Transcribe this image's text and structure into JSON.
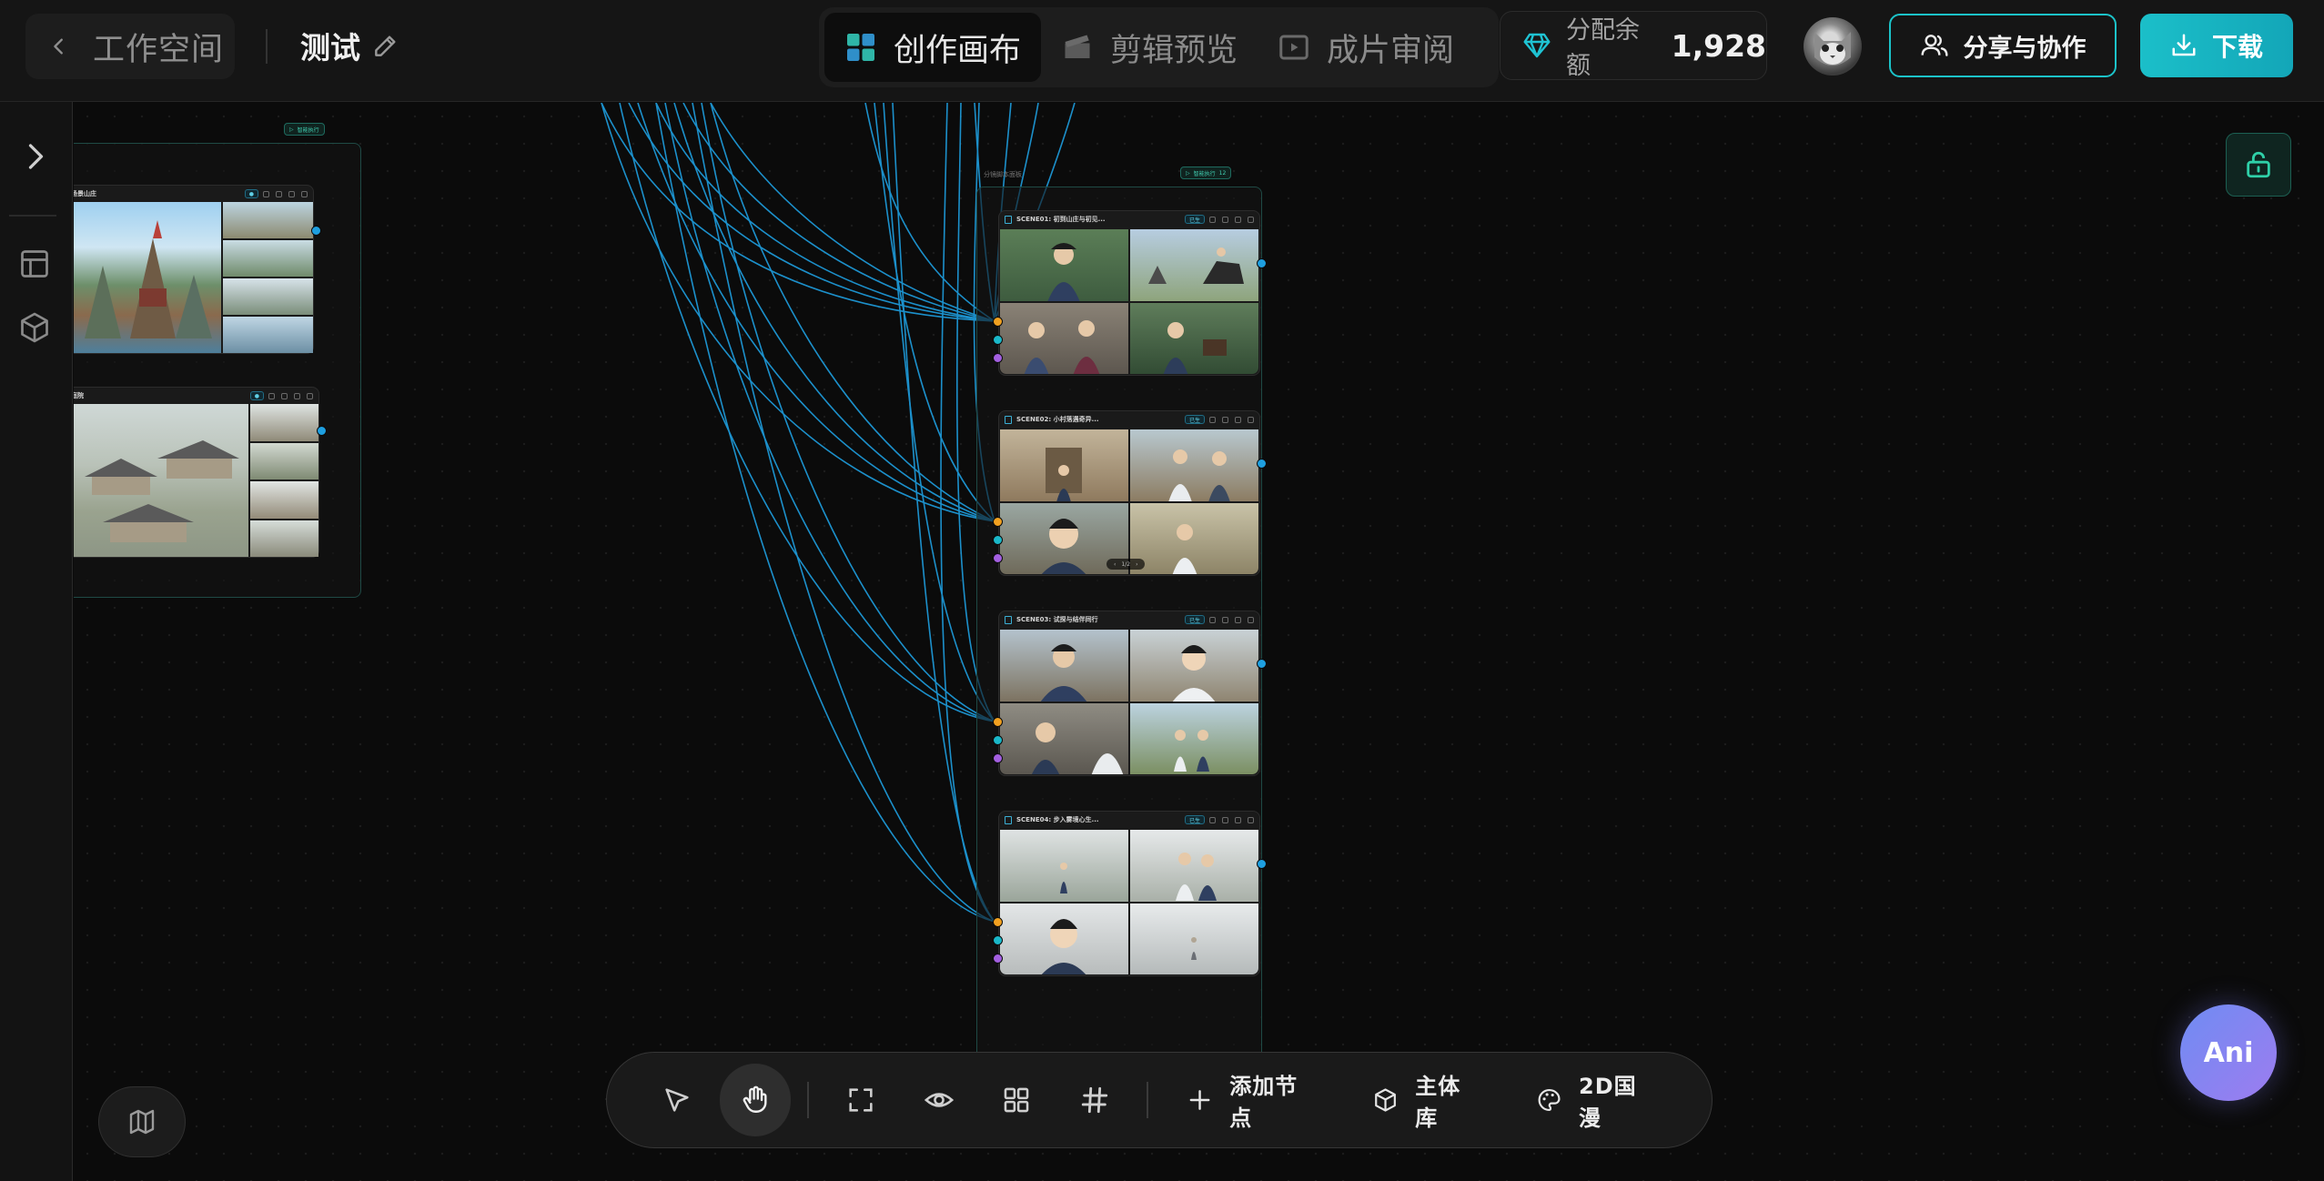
{
  "header": {
    "back_label": "工作空间",
    "project_title": "测试",
    "modes": [
      {
        "label": "创作画布",
        "icon": "grid-icon",
        "active": true
      },
      {
        "label": "剪辑预览",
        "icon": "clapper-icon",
        "active": false
      },
      {
        "label": "成片审阅",
        "icon": "play-box-icon",
        "active": false
      }
    ],
    "balance_label": "分配余额",
    "balance_value": "1,928",
    "share_label": "分享与协作",
    "download_label": "下载"
  },
  "canvas": {
    "left_group_tag": "智能执行",
    "left_nodes": [
      {
        "title": "场景山庄"
      },
      {
        "title": "庭院"
      }
    ],
    "right_group_label": "分镜脚本面板",
    "right_group_tag": "智能执行",
    "right_group_count": "12",
    "storyboard_nodes": [
      {
        "title": "SCENE01: 初到山庄与初见...",
        "chip": "已生"
      },
      {
        "title": "SCENE02: 小村落遇奇异...",
        "chip": "已生",
        "pager": "1/2"
      },
      {
        "title": "SCENE03: 试探与结伴同行",
        "chip": "已生"
      },
      {
        "title": "SCENE04: 步入雾境心生...",
        "chip": "已生"
      }
    ]
  },
  "toolbar": {
    "add_node": "添加节点",
    "asset_library": "主体库",
    "style": "2D国漫"
  },
  "assistant_label": "Ani",
  "colors": {
    "accent": "#1cc3c9",
    "wire": "#1e9fe0",
    "port_orange": "#f0a020",
    "port_purple": "#a35fe0"
  }
}
